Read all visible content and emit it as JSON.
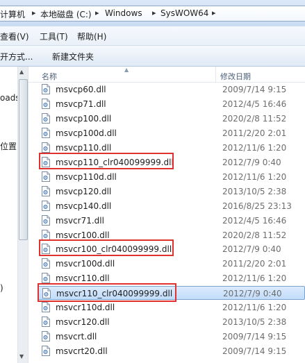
{
  "breadcrumb": {
    "items": [
      "计算机",
      "本地磁盘 (C:)",
      "Windows",
      "SysWOW64"
    ]
  },
  "menu": {
    "view": "查看(V)",
    "tools": "工具(T)",
    "help": "帮助(H)"
  },
  "toolbar": {
    "open_with": "开方式...",
    "new_folder": "新建文件夹"
  },
  "nav": {
    "item1": "oads",
    "item2": "位置",
    "item3": ")"
  },
  "columns": {
    "name": "名称",
    "date": "修改日期"
  },
  "files": [
    {
      "name": "msvcp60.dll",
      "date": "2009/7/14 9:15"
    },
    {
      "name": "msvcp71.dll",
      "date": "2012/4/5 16:46"
    },
    {
      "name": "msvcp100.dll",
      "date": "2020/2/8 11:52"
    },
    {
      "name": "msvcp100d.dll",
      "date": "2011/2/20 2:01"
    },
    {
      "name": "msvcp110.dll",
      "date": "2012/11/6 1:20"
    },
    {
      "name": "msvcp110_clr040099999.dll",
      "date": "2012/7/9 0:40"
    },
    {
      "name": "msvcp110d.dll",
      "date": "2012/11/6 1:20"
    },
    {
      "name": "msvcp120.dll",
      "date": "2013/10/5 2:38"
    },
    {
      "name": "msvcp140.dll",
      "date": "2016/8/25 23:13"
    },
    {
      "name": "msvcr71.dll",
      "date": "2012/4/5 16:46"
    },
    {
      "name": "msvcr100.dll",
      "date": "2020/2/8 11:52"
    },
    {
      "name": "msvcr100_clr040099999.dll",
      "date": "2012/7/9 0:40"
    },
    {
      "name": "msvcr100d.dll",
      "date": "2011/2/20 2:01"
    },
    {
      "name": "msvcr110.dll",
      "date": "2012/11/6 1:20"
    },
    {
      "name": "msvcr110_clr040099999.dll",
      "date": "2012/7/9 0:40"
    },
    {
      "name": "msvcr110d.dll",
      "date": "2012/11/6 1:20"
    },
    {
      "name": "msvcr120.dll",
      "date": "2013/10/5 2:38"
    },
    {
      "name": "msvcrt.dll",
      "date": "2009/7/14 9:15"
    },
    {
      "name": "msvcrt20.dll",
      "date": "2009/7/14 9:15"
    }
  ],
  "selected_file": "msvcr110_clr040099999.dll",
  "highlighted_files": [
    "msvcp110_clr040099999.dll",
    "msvcr100_clr040099999.dll",
    "msvcr110_clr040099999.dll"
  ],
  "colors": {
    "highlight_border": "#e0312f",
    "selection_fill": "#c1dcfb"
  }
}
